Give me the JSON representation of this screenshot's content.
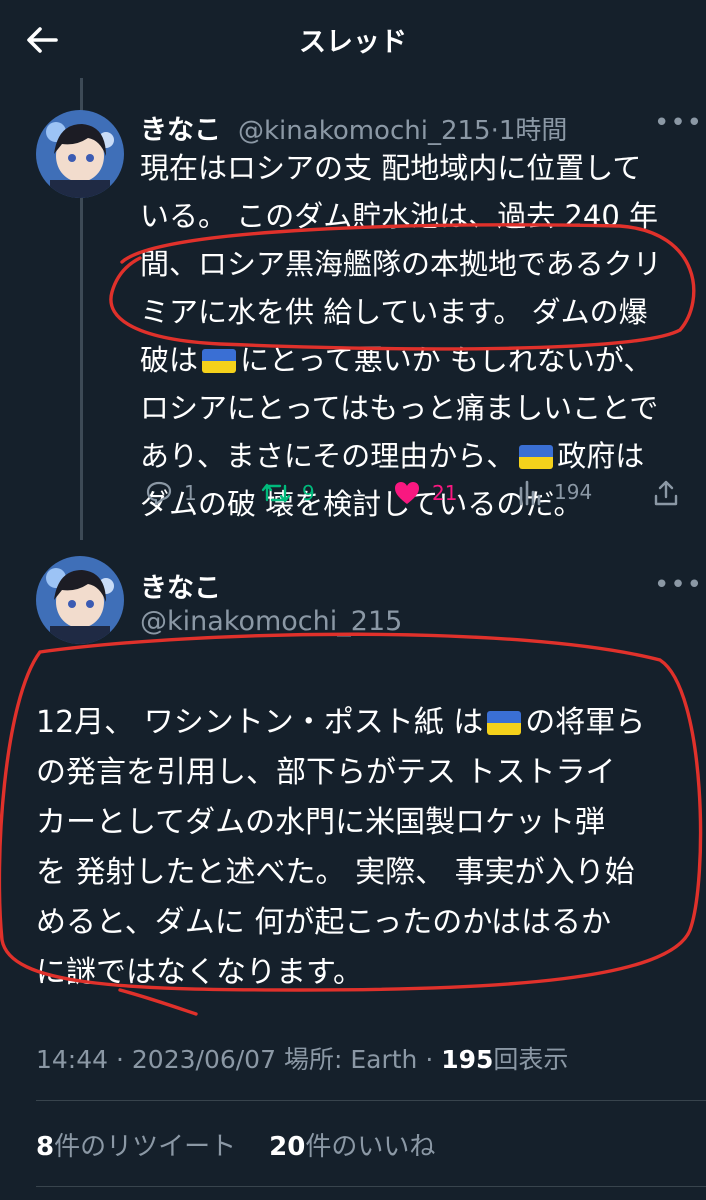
{
  "header": {
    "title": "スレッド"
  },
  "tweet1": {
    "name": "きなこ",
    "handle": "@kinakomochi_215",
    "sep": "·",
    "time": "1時間",
    "text": {
      "l1": "現在はロシアの支 配地域内に位置して",
      "l2": "いる。 このダム貯水池は、過去 240 年",
      "l3": "間、ロシア黒海艦隊の本拠地であるクリ",
      "l4": "ミアに水を供 給しています。 ダムの爆",
      "l5a": "破は",
      "l5b": "にとって悪いか もしれないが、",
      "l6": "ロシアにとってはもっと痛ましいことで",
      "l7a": "あり、まさにその理由から、",
      "l7b": "政府は",
      "l8": "ダムの破 壊を検討しているのだ。"
    },
    "replies": "1",
    "retweets": "9",
    "likes": "21",
    "views": "194"
  },
  "tweet2": {
    "name": "きなこ",
    "handle": "@kinakomochi_215",
    "text": {
      "l1a": "12月、 ワシントン・ポスト紙 は",
      "l1b": "の将軍ら",
      "l2": "の発言を引用し、部下らがテス トストライ",
      "l3": "カーとしてダムの水門に米国製ロケット弾",
      "l4": "を 発射したと述べた。 実際、 事実が入り始",
      "l5": "めると、ダムに 何が起こったのかははるか",
      "l6": "に謎ではなくなります。"
    },
    "time": "14:44",
    "date": "2023/06/07",
    "location": "場所: Earth",
    "view_count": "195",
    "view_label": "回表示",
    "dot": "·",
    "retweet_count": "8",
    "retweet_label": "件のリツイート",
    "like_count": "20",
    "like_label": "件のいいね"
  },
  "colors": {
    "background": "#15202b",
    "muted": "#8b98a5",
    "retweet_green": "#00ba7c",
    "like_pink": "#f91880",
    "annotation_red": "#e0312b"
  }
}
